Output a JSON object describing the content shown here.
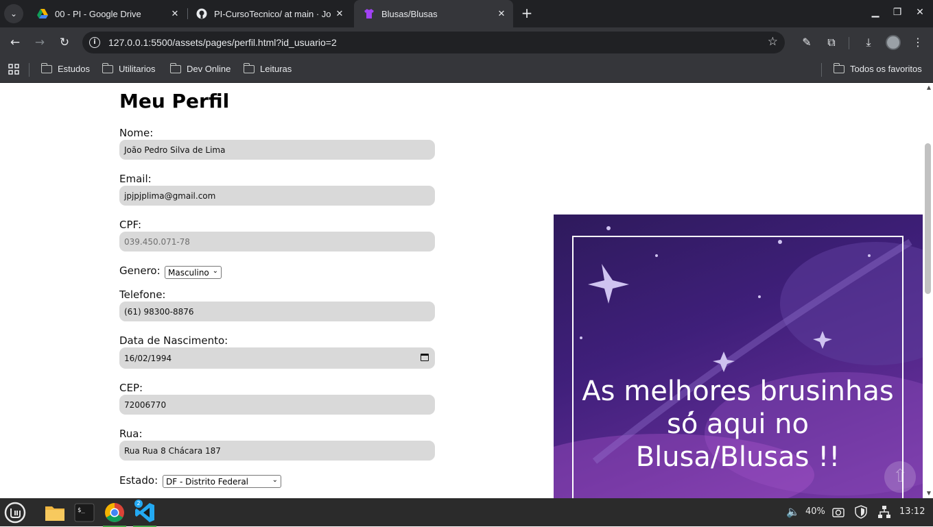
{
  "browser": {
    "tabs": [
      {
        "title": "00 - PI - Google Drive",
        "icon": "google-drive-icon"
      },
      {
        "title": "PI-CursoTecnico/ at main · Jo",
        "icon": "github-icon"
      },
      {
        "title": "Blusas/Blusas",
        "icon": "tshirt-icon",
        "active": true
      }
    ],
    "url": "127.0.0.1:5500/assets/pages/perfil.html?id_usuario=2",
    "bookmarks": [
      "Estudos",
      "Utilitarios",
      "Dev Online",
      "Leituras"
    ],
    "all_bookmarks": "Todos os favoritos"
  },
  "page": {
    "title": "Meu Perfil",
    "fields": {
      "nome": {
        "label": "Nome:",
        "value": "João Pedro Silva de Lima"
      },
      "email": {
        "label": "Email:",
        "value": "jpjpjplima@gmail.com"
      },
      "cpf": {
        "label": "CPF:",
        "value": "039.450.071-78"
      },
      "genero": {
        "label": "Genero:",
        "value": "Masculino"
      },
      "telefone": {
        "label": "Telefone:",
        "value": "(61) 98300-8876"
      },
      "nascimento": {
        "label": "Data de Nascimento:",
        "value": "16/02/1994"
      },
      "cep": {
        "label": "CEP:",
        "value": "72006770"
      },
      "rua": {
        "label": "Rua:",
        "value": "Rua Rua 8 Chácara 187"
      },
      "estado": {
        "label": "Estado:",
        "value": "DF - Distrito Federal"
      }
    },
    "banner": {
      "line1": "As melhores brusinhas",
      "line2": "só aqui no",
      "line3": "Blusa/Blusas !!"
    }
  },
  "taskbar": {
    "volume": "40%",
    "clock": "13:12",
    "vscode_badge": "2"
  }
}
